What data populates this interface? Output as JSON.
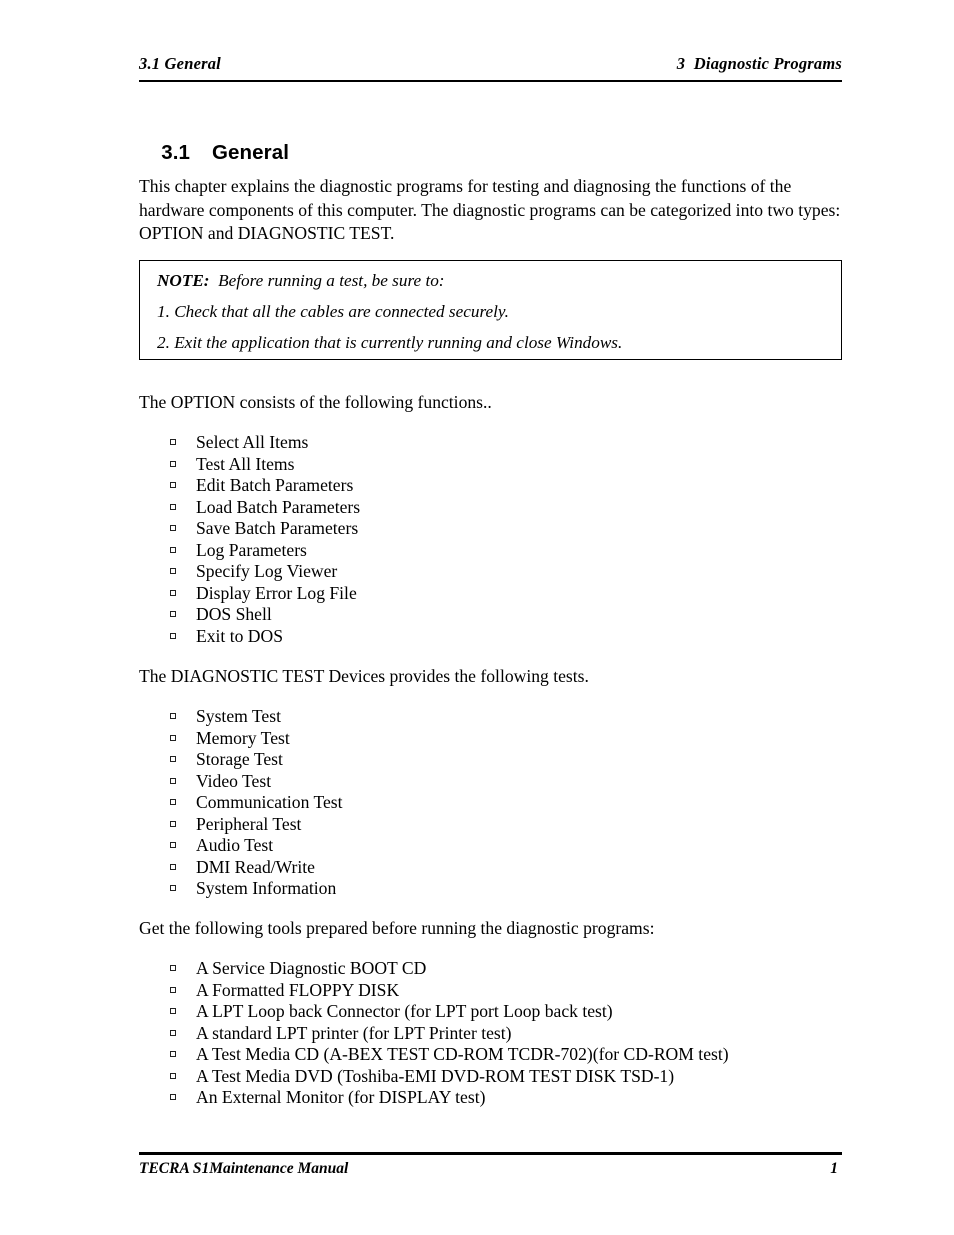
{
  "running_head": {
    "left": "3.1 General",
    "right": "3  Diagnostic Programs"
  },
  "section": {
    "number": "3.1",
    "title": "General"
  },
  "intro_paragraph": "This chapter explains the diagnostic programs for testing and diagnosing the functions of the hardware components of this computer. The diagnostic programs can be categorized into two types: OPTION and DIAGNOSTIC TEST.",
  "note_box": {
    "label": "NOTE:",
    "heading": "Before running a test, be sure to:",
    "items": [
      "1. Check that all the cables are connected securely.",
      "2. Exit the application that is currently running and close Windows."
    ]
  },
  "option_section": {
    "lead": "The OPTION consists of the following functions..",
    "items": [
      "Select All Items",
      "Test All Items",
      "Edit Batch Parameters",
      "Load Batch Parameters",
      "Save Batch Parameters",
      "Log Parameters",
      "Specify Log Viewer",
      "Display Error Log File",
      "DOS Shell",
      "Exit to DOS"
    ]
  },
  "diagnostic_section": {
    "lead": "The DIAGNOSTIC TEST Devices provides the following tests.",
    "items": [
      "System Test",
      "Memory Test",
      "Storage Test",
      "Video Test",
      "Communication Test",
      "Peripheral Test",
      "Audio Test",
      "DMI Read/Write",
      "System Information"
    ]
  },
  "tools_section": {
    "lead": "Get the following tools prepared before running the diagnostic programs:",
    "items": [
      "A Service Diagnostic BOOT CD",
      "A Formatted FLOPPY DISK",
      "A LPT Loop back Connector (for LPT port Loop back test)",
      "A standard LPT printer (for LPT Printer test)",
      "A Test Media CD (A-BEX TEST CD-ROM TCDR-702)(for CD-ROM test)",
      "A Test Media DVD (Toshiba-EMI DVD-ROM TEST DISK TSD-1)",
      "An External Monitor (for DISPLAY test)"
    ]
  },
  "running_foot": {
    "left": "TECRA S1Maintenance Manual",
    "page_number": "1"
  },
  "colors": {
    "text": "#000000",
    "background": "#ffffff",
    "rule": "#000000"
  }
}
